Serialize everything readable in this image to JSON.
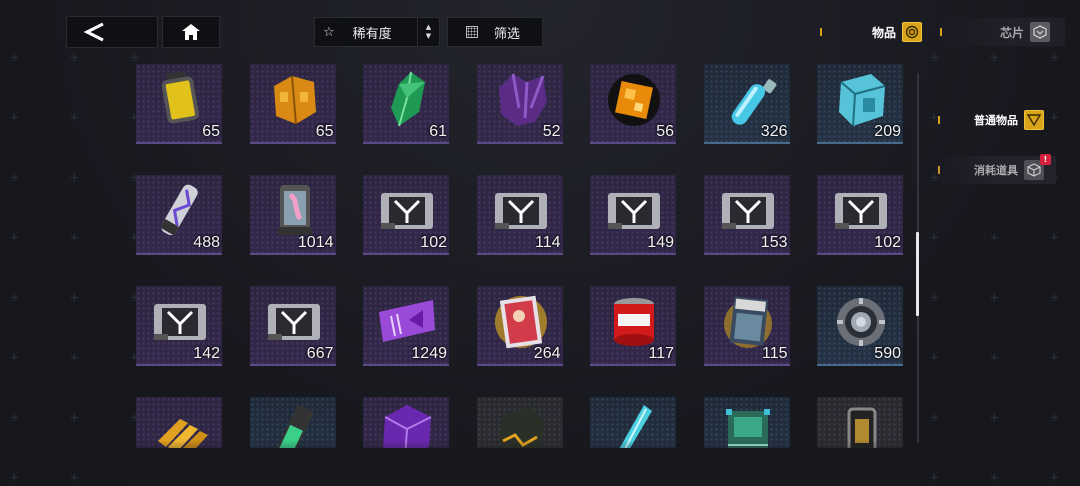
{
  "toolbar": {
    "back_icon": "chevron-left-icon",
    "home_icon": "home-icon",
    "rarity_label": "稀有度",
    "rarity_icon": "star-outline-icon",
    "filter_label": "筛选",
    "filter_icon": "filter-grid-icon"
  },
  "top_tabs": [
    {
      "label": "物品",
      "icon": "items-icon",
      "active": true
    },
    {
      "label": "芯片",
      "icon": "chip-icon",
      "active": false
    }
  ],
  "side_tabs": [
    {
      "label": "普通物品",
      "icon": "items-icon",
      "active": true
    },
    {
      "label": "消耗道具",
      "icon": "cube-icon",
      "active": false,
      "badge": "!"
    }
  ],
  "colors": {
    "accent": "#d7a41a",
    "badge": "#d4203a",
    "purple_frame": "#5a4a86",
    "blue_frame": "#4a6a8c"
  },
  "items": [
    {
      "name": "yellow-canister-icon",
      "qty": "65",
      "frame": "purple"
    },
    {
      "name": "gold-armor-plate-icon",
      "qty": "65",
      "frame": "purple"
    },
    {
      "name": "green-crystal-icon",
      "qty": "61",
      "frame": "purple"
    },
    {
      "name": "purple-crystal-cluster-icon",
      "qty": "52",
      "frame": "purple"
    },
    {
      "name": "orange-data-chip-icon",
      "qty": "56",
      "frame": "purple"
    },
    {
      "name": "blue-vial-icon",
      "qty": "326",
      "frame": "blue"
    },
    {
      "name": "cyan-crate-icon",
      "qty": "209",
      "frame": "blue"
    },
    {
      "name": "hologram-capsule-icon",
      "qty": "488",
      "frame": "purple"
    },
    {
      "name": "figure-capsule-icon",
      "qty": "1014",
      "frame": "purple"
    },
    {
      "name": "emblem-card-icon",
      "qty": "102",
      "frame": "purple"
    },
    {
      "name": "emblem-card-icon",
      "qty": "114",
      "frame": "purple"
    },
    {
      "name": "emblem-card-icon",
      "qty": "149",
      "frame": "purple"
    },
    {
      "name": "emblem-card-icon",
      "qty": "153",
      "frame": "purple"
    },
    {
      "name": "emblem-card-icon",
      "qty": "102",
      "frame": "purple"
    },
    {
      "name": "emblem-card-icon",
      "qty": "142",
      "frame": "purple"
    },
    {
      "name": "emblem-card-icon",
      "qty": "667",
      "frame": "purple"
    },
    {
      "name": "purple-ticket-icon",
      "qty": "1249",
      "frame": "purple"
    },
    {
      "name": "poster-card-icon",
      "qty": "264",
      "frame": "purple"
    },
    {
      "name": "red-jar-icon",
      "qty": "117",
      "frame": "purple"
    },
    {
      "name": "comic-book-icon",
      "qty": "115",
      "frame": "purple"
    },
    {
      "name": "steel-ring-core-icon",
      "qty": "590",
      "frame": "blue"
    },
    {
      "name": "gold-bars-icon",
      "qty": "",
      "frame": "purple"
    },
    {
      "name": "green-battery-icon",
      "qty": "",
      "frame": "blue"
    },
    {
      "name": "violet-cube-icon",
      "qty": "",
      "frame": "purple"
    },
    {
      "name": "dark-ore-icon",
      "qty": "",
      "frame": "grey"
    },
    {
      "name": "cyan-blade-icon",
      "qty": "",
      "frame": "blue"
    },
    {
      "name": "circuit-board-icon",
      "qty": "",
      "frame": "blue"
    },
    {
      "name": "dark-canister-icon",
      "qty": "",
      "frame": "grey"
    }
  ]
}
